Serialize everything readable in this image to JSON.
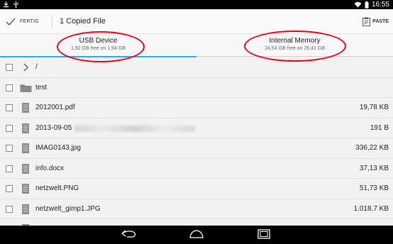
{
  "status": {
    "time": "16:55"
  },
  "toolbar": {
    "done_label": "FERTIG",
    "title": "1 Copied File",
    "paste_label": "PASTE"
  },
  "tabs": [
    {
      "name": "USB Device",
      "sub": "1,92 GB free on 1,94 GB",
      "active": true
    },
    {
      "name": "Internal Memory",
      "sub": "24,54 GB free on 26,41 GB",
      "active": false
    }
  ],
  "files": [
    {
      "name": "/",
      "size": "",
      "icon": "chevron-right-icon"
    },
    {
      "name": "test",
      "size": "",
      "icon": "folder-icon"
    },
    {
      "name": "2012001.pdf",
      "size": "19,78 KB",
      "icon": "file-icon"
    },
    {
      "name": "2013-09-05",
      "size": "191 B",
      "icon": "file-icon"
    },
    {
      "name": "IMAG0143.jpg",
      "size": "336,22 KB",
      "icon": "file-icon"
    },
    {
      "name": "info.docx",
      "size": "37,13 KB",
      "icon": "file-icon"
    },
    {
      "name": "netzwelt.PNG",
      "size": "51,73 KB",
      "icon": "file-icon"
    },
    {
      "name": "netzwelt_gimp1.JPG",
      "size": "1.018,7 KB",
      "icon": "file-icon"
    }
  ],
  "colors": {
    "accent": "#33a8dc",
    "annotation": "#e4001b"
  }
}
